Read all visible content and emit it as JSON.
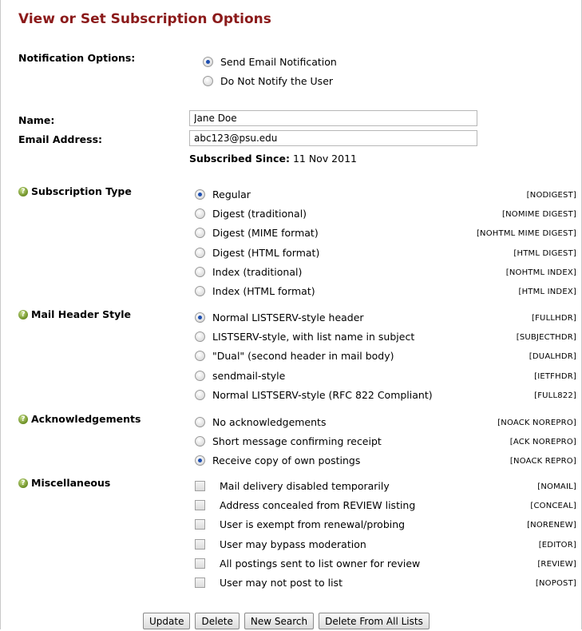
{
  "title": "View or Set Subscription Options",
  "notification": {
    "label": "Notification Options:",
    "options": [
      {
        "label": "Send Email Notification",
        "selected": true
      },
      {
        "label": "Do Not Notify the User",
        "selected": false
      }
    ]
  },
  "name": {
    "label": "Name:",
    "value": "Jane Doe"
  },
  "email": {
    "label": "Email Address:",
    "value": "abc123@psu.edu"
  },
  "subscribed": {
    "label": "Subscribed Since:",
    "value": "11 Nov 2011"
  },
  "subscription_type": {
    "label": "Subscription Type",
    "options": [
      {
        "label": "Regular",
        "code": "[NODIGEST]",
        "selected": true
      },
      {
        "label": "Digest (traditional)",
        "code": "[NOMIME DIGEST]",
        "selected": false
      },
      {
        "label": "Digest (MIME format)",
        "code": "[NOHTML MIME DIGEST]",
        "selected": false
      },
      {
        "label": "Digest (HTML format)",
        "code": "[HTML DIGEST]",
        "selected": false
      },
      {
        "label": "Index (traditional)",
        "code": "[NOHTML INDEX]",
        "selected": false
      },
      {
        "label": "Index (HTML format)",
        "code": "[HTML INDEX]",
        "selected": false
      }
    ]
  },
  "mail_header": {
    "label": "Mail Header Style",
    "options": [
      {
        "label": "Normal LISTSERV-style header",
        "code": "[FULLHDR]",
        "selected": true
      },
      {
        "label": "LISTSERV-style, with list name in subject",
        "code": "[SUBJECTHDR]",
        "selected": false
      },
      {
        "label": "\"Dual\" (second header in mail body)",
        "code": "[DUALHDR]",
        "selected": false
      },
      {
        "label": "sendmail-style",
        "code": "[IETFHDR]",
        "selected": false
      },
      {
        "label": "Normal LISTSERV-style (RFC 822 Compliant)",
        "code": "[FULL822]",
        "selected": false
      }
    ]
  },
  "acknowledgements": {
    "label": "Acknowledgements",
    "options": [
      {
        "label": "No acknowledgements",
        "code": "[NOACK NOREPRO]",
        "selected": false
      },
      {
        "label": "Short message confirming receipt",
        "code": "[ACK NOREPRO]",
        "selected": false
      },
      {
        "label": "Receive copy of own postings",
        "code": "[NOACK REPRO]",
        "selected": true
      }
    ]
  },
  "misc": {
    "label": "Miscellaneous",
    "options": [
      {
        "label": "Mail delivery disabled temporarily",
        "code": "[NOMAIL]",
        "checked": false
      },
      {
        "label": "Address concealed from REVIEW listing",
        "code": "[CONCEAL]",
        "checked": false
      },
      {
        "label": "User is exempt from renewal/probing",
        "code": "[NORENEW]",
        "checked": false
      },
      {
        "label": "User may bypass moderation",
        "code": "[EDITOR]",
        "checked": false
      },
      {
        "label": "All postings sent to list owner for review",
        "code": "[REVIEW]",
        "checked": false
      },
      {
        "label": "User may not post to list",
        "code": "[NOPOST]",
        "checked": false
      }
    ]
  },
  "buttons": {
    "update": "Update",
    "delete": "Delete",
    "new_search": "New Search",
    "delete_all": "Delete From All Lists"
  },
  "help_icon": "help-icon"
}
